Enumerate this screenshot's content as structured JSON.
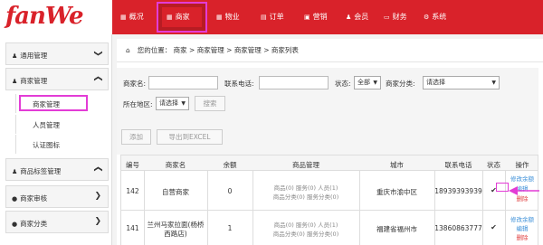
{
  "app": {
    "logo_text": "fanWe"
  },
  "colors": {
    "brand": "#d9222a",
    "highlight": "#e33cd6",
    "link": "#3b8fd8",
    "delete": "#e04040"
  },
  "nav": [
    {
      "icon": "grid-icon",
      "glyph": "▦",
      "label": "概况"
    },
    {
      "icon": "grid-icon",
      "glyph": "▦",
      "label": "商家"
    },
    {
      "icon": "grid-icon",
      "glyph": "▦",
      "label": "物业"
    },
    {
      "icon": "list-icon",
      "glyph": "▤",
      "label": "订单"
    },
    {
      "icon": "chat-icon",
      "glyph": "▣",
      "label": "营销"
    },
    {
      "icon": "user-icon",
      "glyph": "♟",
      "label": "会员"
    },
    {
      "icon": "card-icon",
      "glyph": "▭",
      "label": "财务"
    },
    {
      "icon": "gear-icon",
      "glyph": "⚙",
      "label": "系统"
    }
  ],
  "sidebar": {
    "groups": [
      {
        "label": "通用管理",
        "icon": "user-icon",
        "glyph": "♟",
        "chevron": "❯",
        "state": "collapsed"
      },
      {
        "label": "商家管理",
        "icon": "user-icon",
        "glyph": "♟",
        "chevron": "❮",
        "state": "expanded"
      },
      {
        "label": "商品标签管理",
        "icon": "user-icon",
        "glyph": "♟",
        "chevron": "❮",
        "state": "expanded"
      },
      {
        "label": "商家审核",
        "icon": "chat-icon",
        "glyph": "●",
        "chevron": "❯",
        "state": "collapsed"
      },
      {
        "label": "商家分类",
        "icon": "chat-icon",
        "glyph": "●",
        "chevron": "❯",
        "state": "collapsed"
      }
    ],
    "sub_items": [
      {
        "label": "商家管理",
        "selected": true
      },
      {
        "label": "人员管理",
        "selected": false
      },
      {
        "label": "认证图标",
        "selected": false
      }
    ]
  },
  "breadcrumb": {
    "home_icon": "home-icon",
    "prefix": "您的位置：",
    "items": [
      "商家",
      "商家管理",
      "商家管理",
      "商家列表"
    ],
    "separator": ">"
  },
  "filters": {
    "merchant_name_label": "商家名:",
    "phone_label": "联系电话:",
    "status_label": "状态:",
    "status_value": "全部",
    "category_label": "商家分类:",
    "category_value": "请选择",
    "region_label": "所在地区:",
    "region_value": "请选择",
    "search_button": "搜索"
  },
  "actions": {
    "add_button": "添加",
    "export_button": "导出到EXCEL"
  },
  "table": {
    "headers": [
      "编号",
      "商家名",
      "余额",
      "商品管理",
      "城市",
      "联系电话",
      "状态",
      "操作"
    ],
    "rows": [
      {
        "id": "142",
        "name": "自营商家",
        "balance": "0",
        "goods_line1": "商品(0)  服务(0)  人员(1)",
        "goods_line2": "商品分类(0)  服务分类(0)",
        "city": "重庆市渝中区",
        "phone": "18939393939",
        "status": "✔",
        "action_edit_balance": "修改余额",
        "action_edit": "编辑",
        "action_delete": "删除"
      },
      {
        "id": "141",
        "name_line1": "兰州马家拉面(杨桥",
        "name_line2": "西路店)",
        "balance": "1",
        "goods_line1": "商品(0)  服务(0)  人员(1)",
        "goods_line2": "商品分类(0)  服务分类(0)",
        "city": "福建省福州市",
        "phone": "13860863777",
        "status": "✔",
        "action_edit_balance": "修改余额",
        "action_edit": "编辑",
        "action_delete": "删除"
      }
    ]
  }
}
